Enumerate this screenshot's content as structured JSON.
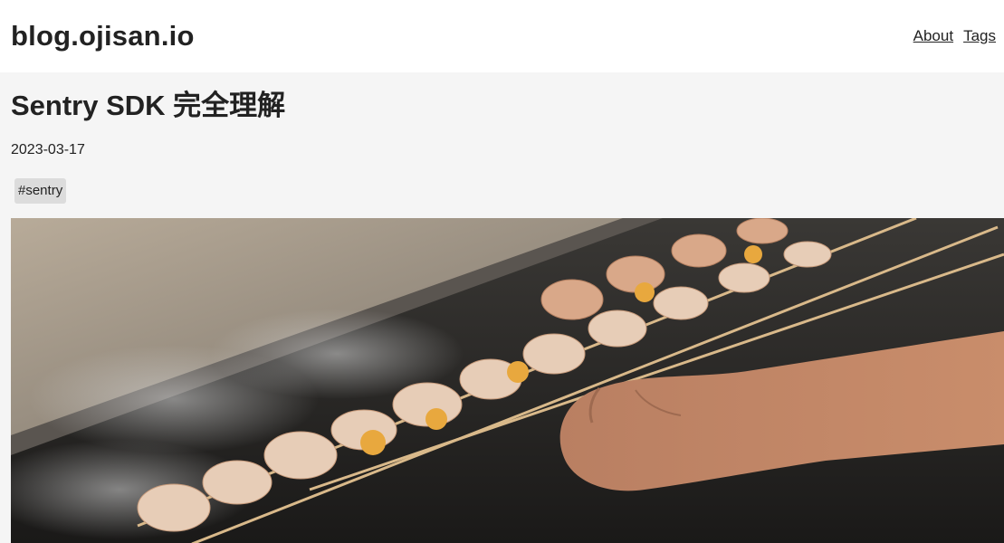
{
  "site": {
    "title": "blog.ojisan.io"
  },
  "nav": {
    "items": [
      {
        "label": "About"
      },
      {
        "label": "Tags"
      }
    ]
  },
  "post": {
    "title": "Sentry SDK 完全理解",
    "date": "2023-03-17",
    "tags": [
      {
        "label": "#sentry"
      }
    ]
  },
  "colors": {
    "header_bg": "#ffffff",
    "page_bg": "#f5f5f5",
    "tag_bg": "#dcdcdc",
    "text": "#222222"
  }
}
